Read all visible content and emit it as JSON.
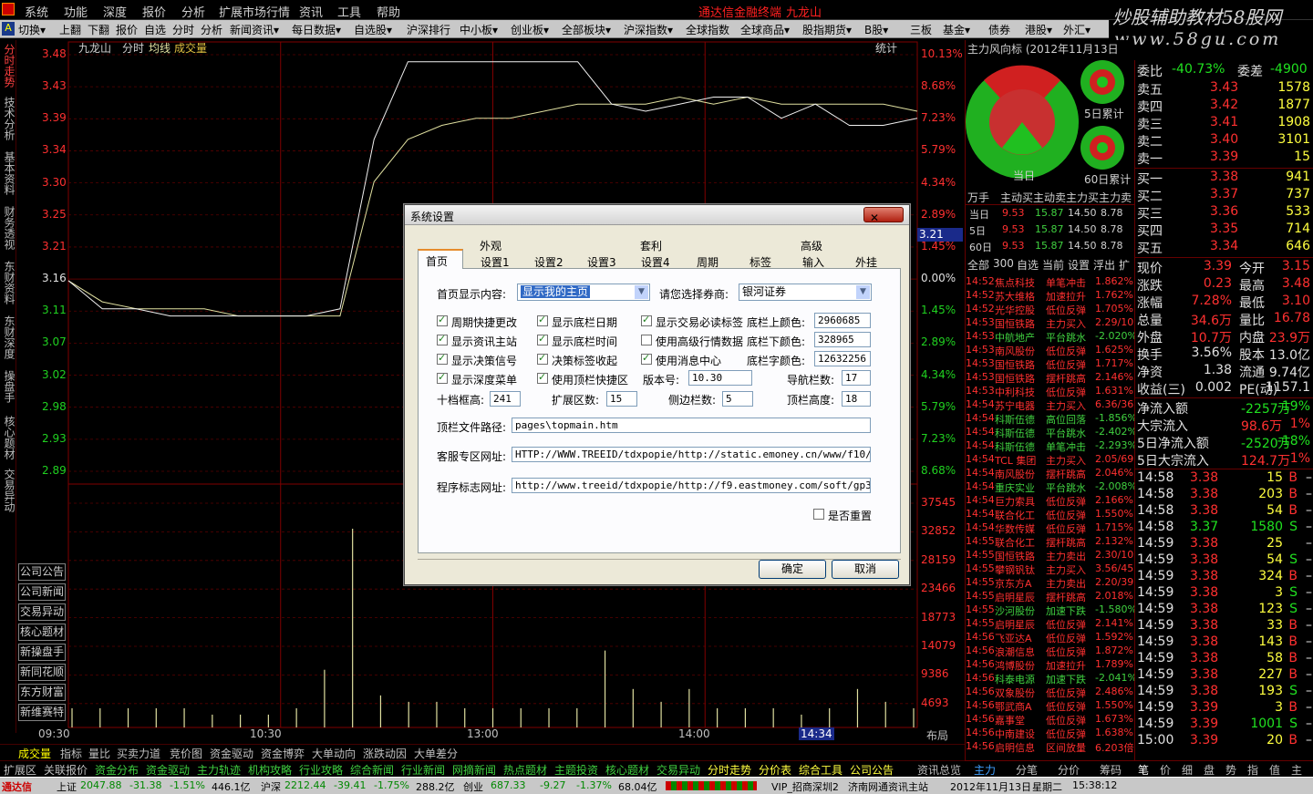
{
  "menu": [
    "系统",
    "功能",
    "深度",
    "报价",
    "分析",
    "扩展市场行情",
    "资讯",
    "工具",
    "帮助"
  ],
  "brand": "通达信金融终端",
  "brand_stock": "九龙山",
  "watermark": {
    "line1": "炒股辅助教材58股网",
    "line2": "www.58gu.com"
  },
  "toolbar": [
    "切换▾",
    "上翻",
    "下翻",
    "报价",
    "自选",
    "分时",
    "分析",
    "新闻资讯▾",
    "每日数据▾",
    "自选股▾",
    "沪深排行",
    "中小板▾",
    "创业板▾",
    "全部板块▾",
    "沪深指数▾",
    "全球指数",
    "全球商品▾",
    "股指期货▾",
    "B股▾",
    "三板",
    "基金▾",
    "债券",
    "港股▾",
    "外汇▾"
  ],
  "left_tabs": [
    "分时走势",
    "技术分析",
    "基本资料",
    "财务透视",
    "东财资料",
    "东财深度",
    "操盘手",
    "核心题材",
    "交易异动"
  ],
  "chart_header": {
    "stock": "九龙山",
    "mode": "分时",
    "avg": "均线",
    "vol": "成交量",
    "stats": "统计"
  },
  "price_labels": [
    "3.48",
    "3.43",
    "3.39",
    "3.34",
    "3.30",
    "3.25",
    "3.21",
    "3.16",
    "3.11",
    "3.07",
    "3.02",
    "2.98",
    "2.93",
    "2.89"
  ],
  "pct_labels": [
    "10.13%",
    "8.68%",
    "7.23%",
    "5.79%",
    "4.34%",
    "2.89%",
    "1.45%",
    "0.00%",
    "1.45%",
    "2.89%",
    "4.34%",
    "5.79%",
    "7.23%",
    "8.68%"
  ],
  "vol_labels": [
    "37545",
    "32852",
    "28159",
    "23466",
    "18773",
    "14079",
    "9386",
    "4693"
  ],
  "cur_price_tag": "3.21",
  "side_buttons": [
    "公司公告",
    "公司新闻",
    "交易异动",
    "核心题材",
    "新操盘手",
    "新同花顺",
    "东方财富",
    "新维赛特"
  ],
  "time_labels": [
    "09:30",
    "10:30",
    "13:00",
    "14:00",
    "14:34"
  ],
  "time_axis_right": "布局",
  "bottom_tabs1": [
    "成交量",
    "指标",
    "量比",
    "买卖力道",
    "竞价图",
    "资金驱动",
    "资金博弈",
    "大单动向",
    "涨跌动因",
    "大单差分"
  ],
  "bottom_tabs2": [
    "扩展区",
    "关联报价",
    "资金分布",
    "资金驱动",
    "主力轨迹",
    "机构攻略",
    "行业攻略",
    "综合新闻",
    "行业新闻",
    "网摘新闻",
    "热点题材",
    "主题投资",
    "核心题材",
    "交易异动",
    "分时走势",
    "分价表",
    "综合工具",
    "公司公告",
    "资讯总览"
  ],
  "status": {
    "idx1_name": "上证",
    "idx1_val": "2047.88",
    "idx1_chg": "-31.38",
    "idx1_pct": "-1.51%",
    "idx1_amt": "446.1亿",
    "idx2_name": "沪深",
    "idx2_val": "2212.44",
    "idx2_chg": "-39.41",
    "idx2_pct": "-1.75%",
    "idx2_amt": "288.2亿",
    "idx3_name": "创业",
    "idx3_val": "687.33",
    "idx3_chg": "-9.27",
    "idx3_pct": "-1.37%",
    "idx3_amt": "68.04亿",
    "server": "VIP_招商深圳2",
    "server2": "济南网通资讯主站",
    "date": "2012年11月13日",
    "weekday": "星期二",
    "time": "15:38:12",
    "logo": "通达信"
  },
  "mid_panel": {
    "title": "主力风向标 (2012年11月13日",
    "labels": {
      "today": "当日",
      "d5": "5日累计",
      "d60": "60日累计"
    },
    "table_head": [
      "万手",
      "主动买",
      "主动卖",
      "主力买",
      "主力卖"
    ],
    "rows": [
      {
        "name": "当日",
        "v": [
          "9.53",
          "15.87",
          "14.50",
          "8.78"
        ]
      },
      {
        "name": "5日",
        "v": [
          "9.53",
          "15.87",
          "14.50",
          "8.78"
        ]
      },
      {
        "name": "60日",
        "v": [
          "9.53",
          "15.87",
          "14.50",
          "8.78"
        ]
      }
    ],
    "tabs": [
      "全部",
      "300",
      "自选",
      "当前",
      "设置",
      "浮出",
      "扩"
    ],
    "news": [
      [
        "14:52",
        "焦点科技",
        "单笔冲击",
        "1.862%"
      ],
      [
        "14:52",
        "苏大维格",
        "加速拉升",
        "1.762%"
      ],
      [
        "14:52",
        "光华控股",
        "低位反弹",
        "1.705%"
      ],
      [
        "14:53",
        "国恒铁路",
        "主力买入",
        "2.29/10"
      ],
      [
        "14:53",
        "中航地产",
        "平台跳水",
        "-2.020%"
      ],
      [
        "14:53",
        "南风股份",
        "低位反弹",
        "1.625%"
      ],
      [
        "14:53",
        "国恒铁路",
        "低位反弹",
        "1.717%"
      ],
      [
        "14:53",
        "国恒铁路",
        "摆杆跳高",
        "2.146%"
      ],
      [
        "14:53",
        "中利科技",
        "低位反弹",
        "1.631%"
      ],
      [
        "14:54",
        "苏宁电器",
        "主力买入",
        "6.36/36"
      ],
      [
        "14:54",
        "科斯伍德",
        "高位回落",
        "-1.856%"
      ],
      [
        "14:54",
        "科斯伍德",
        "平台跳水",
        "-2.402%"
      ],
      [
        "14:54",
        "科斯伍德",
        "单笔冲击",
        "-2.293%"
      ],
      [
        "14:54",
        "TCL 集团",
        "主力买入",
        "2.05/69"
      ],
      [
        "14:54",
        "南风股份",
        "摆杆跳高",
        "2.046%"
      ],
      [
        "14:54",
        "重庆实业",
        "平台跳水",
        "-2.008%"
      ],
      [
        "14:54",
        "巨力索具",
        "低位反弹",
        "2.166%"
      ],
      [
        "14:54",
        "联合化工",
        "低位反弹",
        "1.550%"
      ],
      [
        "14:54",
        "华数传媒",
        "低位反弹",
        "1.715%"
      ],
      [
        "14:55",
        "联合化工",
        "摆杆跳高",
        "2.132%"
      ],
      [
        "14:55",
        "国恒铁路",
        "主力卖出",
        "2.30/10"
      ],
      [
        "14:55",
        "攀钢钒钛",
        "主力买入",
        "3.56/45"
      ],
      [
        "14:55",
        "京东方A",
        "主力卖出",
        "2.20/39"
      ],
      [
        "14:55",
        "启明星辰",
        "摆杆跳高",
        "2.018%"
      ],
      [
        "14:55",
        "沙河股份",
        "加速下跌",
        "-1.580%"
      ],
      [
        "14:55",
        "启明星辰",
        "低位反弹",
        "2.141%"
      ],
      [
        "14:56",
        "飞亚达A",
        "低位反弹",
        "1.592%"
      ],
      [
        "14:56",
        "浪潮信息",
        "低位反弹",
        "1.872%"
      ],
      [
        "14:56",
        "鸿博股份",
        "加速拉升",
        "1.789%"
      ],
      [
        "14:56",
        "科泰电源",
        "加速下跌",
        "-2.041%"
      ],
      [
        "14:56",
        "双象股份",
        "低位反弹",
        "2.486%"
      ],
      [
        "14:56",
        "鄂武商A",
        "低位反弹",
        "1.550%"
      ],
      [
        "14:56",
        "嘉事堂",
        "低位反弹",
        "1.673%"
      ],
      [
        "14:56",
        "中南建设",
        "低位反弹",
        "1.638%"
      ],
      [
        "14:56",
        "启明信息",
        "区间放量",
        "6.203倍"
      ]
    ],
    "bottom": [
      "主力",
      "分笔",
      "分价",
      "筹码"
    ]
  },
  "right_panel": {
    "top_partial": "------ 九龙山",
    "weibi": {
      "label": "委比",
      "val": "-40.73%",
      "label2": "委差",
      "val2": "-4900"
    },
    "sells": [
      [
        "卖五",
        "3.43",
        "1578"
      ],
      [
        "卖四",
        "3.42",
        "1877"
      ],
      [
        "卖三",
        "3.41",
        "1908"
      ],
      [
        "卖二",
        "3.40",
        "3101"
      ],
      [
        "卖一",
        "3.39",
        "15"
      ]
    ],
    "buys": [
      [
        "买一",
        "3.38",
        "941"
      ],
      [
        "买二",
        "3.37",
        "737"
      ],
      [
        "买三",
        "3.36",
        "533"
      ],
      [
        "买四",
        "3.35",
        "714"
      ],
      [
        "买五",
        "3.34",
        "646"
      ]
    ],
    "quote": [
      [
        "现价",
        "3.39",
        "今开",
        "3.15"
      ],
      [
        "涨跌",
        "0.23",
        "最高",
        "3.48"
      ],
      [
        "涨幅",
        "7.28%",
        "最低",
        "3.10"
      ],
      [
        "总量",
        "34.6万",
        "量比",
        "16.78"
      ],
      [
        "外盘",
        "10.7万",
        "内盘",
        "23.9万"
      ],
      [
        "换手",
        "3.56%",
        "股本",
        "13.0亿"
      ],
      [
        "净资",
        "1.38",
        "流通",
        "9.74亿"
      ],
      [
        "收益(三)",
        "0.002",
        "PE(动)",
        "1157.1"
      ]
    ],
    "flows": [
      [
        "净流入额",
        "-2257万",
        "-19%"
      ],
      [
        "大宗流入",
        "98.6万",
        "1%"
      ],
      [
        "5日净流入额",
        "-2520万",
        "-18%"
      ],
      [
        "5日大宗流入",
        "124.7万",
        "1%"
      ]
    ],
    "ticks": [
      [
        "14:58",
        "3.38",
        "15",
        "B"
      ],
      [
        "14:58",
        "3.38",
        "203",
        "B"
      ],
      [
        "14:58",
        "3.38",
        "54",
        "B"
      ],
      [
        "14:58",
        "3.37",
        "1580",
        "S"
      ],
      [
        "14:59",
        "3.38",
        "25",
        ""
      ],
      [
        "14:59",
        "3.38",
        "54",
        "S"
      ],
      [
        "14:59",
        "3.38",
        "324",
        "B"
      ],
      [
        "14:59",
        "3.38",
        "3",
        "S"
      ],
      [
        "14:59",
        "3.38",
        "123",
        "S"
      ],
      [
        "14:59",
        "3.38",
        "33",
        "B"
      ],
      [
        "14:59",
        "3.38",
        "143",
        "B"
      ],
      [
        "14:59",
        "3.38",
        "58",
        "B"
      ],
      [
        "14:59",
        "3.38",
        "227",
        "B"
      ],
      [
        "14:59",
        "3.38",
        "193",
        "S"
      ],
      [
        "14:59",
        "3.39",
        "3",
        "B"
      ],
      [
        "14:59",
        "3.39",
        "1001",
        "S"
      ],
      [
        "15:00",
        "3.39",
        "20",
        "B"
      ]
    ],
    "bottom": [
      "笔",
      "价",
      "细",
      "盘",
      "势",
      "指",
      "值",
      "主"
    ]
  },
  "dialog": {
    "title": "系统设置",
    "close": "关闭",
    "group_tabs": [
      "外观",
      "套利",
      "高级"
    ],
    "tabs": [
      "首页",
      "设置1",
      "设置2",
      "设置3",
      "设置4",
      "周期",
      "标签",
      "输入",
      "外挂"
    ],
    "home_label": "首页显示内容:",
    "home_value": "显示我的主页",
    "broker_label": "请您选择券商:",
    "broker_value": "银河证券",
    "checks": [
      {
        "label": "周期快捷更改",
        "on": true
      },
      {
        "label": "显示底栏日期",
        "on": true
      },
      {
        "label": "显示交易必读标签",
        "on": true
      },
      {
        "label": "显示资讯主站",
        "on": true
      },
      {
        "label": "显示底栏时间",
        "on": true
      },
      {
        "label": "使用高级行情数据",
        "on": false
      },
      {
        "label": "显示决策信号",
        "on": true
      },
      {
        "label": "决策标签收起",
        "on": true
      },
      {
        "label": "使用消息中心",
        "on": true
      },
      {
        "label": "显示深度菜单",
        "on": true
      },
      {
        "label": "使用顶栏快捷区",
        "on": true
      }
    ],
    "color_up_label": "底栏上颜色:",
    "color_up": "2960685",
    "color_down_label": "底栏下颜色:",
    "color_down": "328965",
    "color_font_label": "底栏字颜色:",
    "color_font": "12632256",
    "version_label": "版本号:",
    "version": "10.30",
    "nav_label": "导航栏数:",
    "nav": "17",
    "ten_label": "十档框高:",
    "ten": "241",
    "ext_label": "扩展区数:",
    "ext": "15",
    "side_label": "侧边栏数:",
    "side": "5",
    "top_label": "顶栏高度:",
    "top": "18",
    "path_label": "顶栏文件路径:",
    "path": "pages\\topmain.htm",
    "service_label": "客服专区网址:",
    "service": "HTTP://WWW.TREEID/tdxpopie/http://static.emoney.cn/www/f10/f10/cp",
    "logo_label": "程序标志网址:",
    "logo": "http://www.treeid/tdxpopie/http://f9.eastmoney.com/soft/gp30.php?",
    "reset_label": "是否重置",
    "ok": "确定",
    "cancel": "取消"
  },
  "chart_data": {
    "type": "line",
    "ylim": [
      2.89,
      3.48
    ],
    "series": [
      {
        "values": [
          3.16,
          3.12,
          3.12,
          3.11,
          3.11,
          3.11,
          3.11,
          3.11,
          3.12,
          3.36,
          3.47,
          3.47,
          3.47,
          3.47,
          3.47,
          3.47,
          3.41,
          3.4,
          3.41,
          3.42,
          3.42,
          3.39,
          3.41,
          3.38,
          3.38,
          3.39
        ]
      },
      {
        "values": [
          3.16,
          3.13,
          3.12,
          3.12,
          3.12,
          3.11,
          3.11,
          3.11,
          3.11,
          3.3,
          3.36,
          3.38,
          3.39,
          3.39,
          3.4,
          3.41,
          3.41,
          3.41,
          3.42,
          3.41,
          3.42,
          3.41,
          3.41,
          3.41,
          3.41,
          3.4
        ]
      }
    ],
    "volumes": [
      3,
      3,
      3,
      3,
      3,
      2,
      2,
      2,
      3,
      9,
      31,
      5,
      4,
      4,
      3,
      3,
      3,
      3,
      3,
      12,
      6,
      4,
      6,
      3,
      3,
      3,
      2,
      3,
      6,
      4,
      3
    ]
  }
}
